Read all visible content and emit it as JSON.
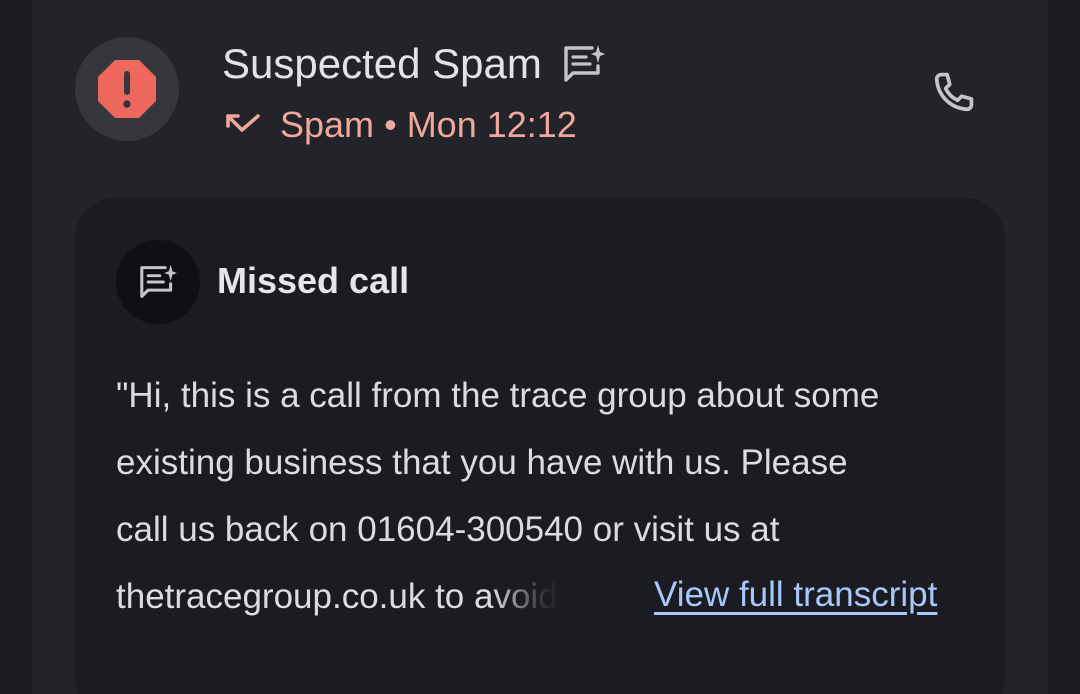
{
  "header": {
    "title": "Suspected Spam",
    "call_type": "Spam",
    "separator": "•",
    "time": "Mon 12:12",
    "icons": {
      "avatar": "spam-warning-icon",
      "title_badge": "ai-transcript-icon",
      "call_direction": "missed-call-icon",
      "action": "phone-icon"
    }
  },
  "card": {
    "title": "Missed call",
    "icon": "ai-transcript-icon",
    "transcript_lines": [
      "\"Hi, this is a call from the trace group about some",
      "existing business that you have with us. Please",
      "call us back on 01604-300540 or visit us at",
      "thetracegroup.co.uk to avoid"
    ],
    "view_full_transcript": "View full transcript"
  },
  "colors": {
    "background": "#22242a",
    "card": "#1b1c21",
    "spam_red": "#ee675c",
    "spam_text": "#f0a79c",
    "link": "#a8c7fa"
  }
}
